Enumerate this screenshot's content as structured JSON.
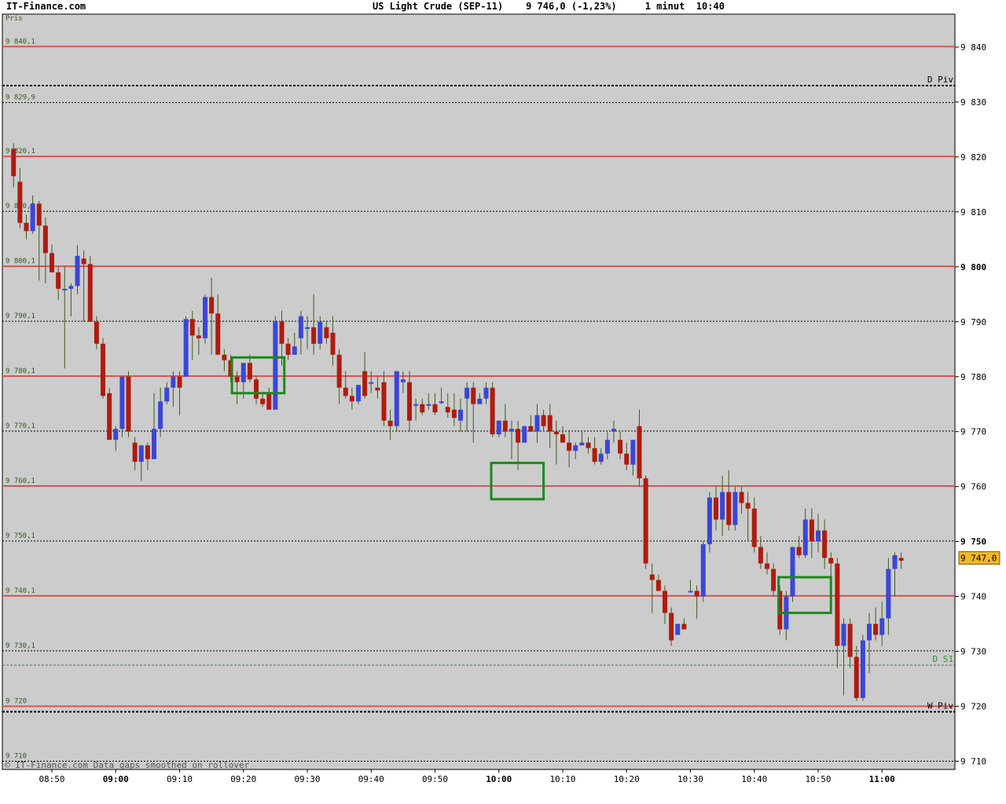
{
  "header": {
    "site": "IT-Finance.com",
    "title": "US Light Crude (SEP-11)    9 746,0 (-1,23%)     1 minut  10:40"
  },
  "chart_data": {
    "type": "candlestick",
    "ylim": [
      9708.5,
      9846
    ],
    "y_ticks": [
      {
        "v": 9840,
        "label": "9 840",
        "bold": false
      },
      {
        "v": 9830,
        "label": "9 830",
        "bold": false
      },
      {
        "v": 9820,
        "label": "9 820",
        "bold": false
      },
      {
        "v": 9810,
        "label": "9 810",
        "bold": false
      },
      {
        "v": 9800,
        "label": "9 800",
        "bold": true
      },
      {
        "v": 9790,
        "label": "9 790",
        "bold": false
      },
      {
        "v": 9780,
        "label": "9 780",
        "bold": false
      },
      {
        "v": 9770,
        "label": "9 770",
        "bold": false
      },
      {
        "v": 9760,
        "label": "9 760",
        "bold": false
      },
      {
        "v": 9750,
        "label": "9 750",
        "bold": true
      },
      {
        "v": 9740,
        "label": "9 740",
        "bold": false
      },
      {
        "v": 9730,
        "label": "9 730",
        "bold": false
      },
      {
        "v": 9720,
        "label": "9 720",
        "bold": false
      },
      {
        "v": 9710,
        "label": "9 710",
        "bold": false
      }
    ],
    "x_ticks": [
      {
        "t": 0,
        "label": "08:50",
        "bold": false
      },
      {
        "t": 10,
        "label": "09:00",
        "bold": true
      },
      {
        "t": 20,
        "label": "09:10",
        "bold": false
      },
      {
        "t": 30,
        "label": "09:20",
        "bold": false
      },
      {
        "t": 40,
        "label": "09:30",
        "bold": false
      },
      {
        "t": 50,
        "label": "09:40",
        "bold": false
      },
      {
        "t": 60,
        "label": "09:50",
        "bold": false
      },
      {
        "t": 70,
        "label": "10:00",
        "bold": true
      },
      {
        "t": 80,
        "label": "10:10",
        "bold": false
      },
      {
        "t": 90,
        "label": "10:20",
        "bold": false
      },
      {
        "t": 100,
        "label": "10:30",
        "bold": false
      },
      {
        "t": 110,
        "label": "10:40",
        "bold": false
      },
      {
        "t": 120,
        "label": "10:50",
        "bold": false
      },
      {
        "t": 130,
        "label": "11:00",
        "bold": true
      }
    ],
    "levels": [
      {
        "v": 9840.1,
        "label": "9 840,1",
        "style": "red"
      },
      {
        "v": 9829.9,
        "label": "9 829,9",
        "style": "dash"
      },
      {
        "v": 9820.1,
        "label": "9 820,1",
        "style": "red"
      },
      {
        "v": 9810.1,
        "label": "9 810,1",
        "style": "dash"
      },
      {
        "v": 9800.1,
        "label": "9 800,1",
        "style": "red"
      },
      {
        "v": 9790.1,
        "label": "9 790,1",
        "style": "dash"
      },
      {
        "v": 9780.1,
        "label": "9 780,1",
        "style": "red"
      },
      {
        "v": 9770.1,
        "label": "9 770,1",
        "style": "dash"
      },
      {
        "v": 9760.1,
        "label": "9 760,1",
        "style": "red"
      },
      {
        "v": 9750.1,
        "label": "9 750,1",
        "style": "dash"
      },
      {
        "v": 9740.1,
        "label": "9 740,1",
        "style": "red"
      },
      {
        "v": 9730.1,
        "label": "9 730,1",
        "style": "dash"
      },
      {
        "v": 9720,
        "label": "9 720",
        "style": "red"
      },
      {
        "v": 9710,
        "label": "9 710",
        "style": "dash"
      }
    ],
    "pivots": [
      {
        "v": 9833,
        "label": "D Piv",
        "color": "#000000",
        "style": "bold-dash"
      },
      {
        "v": 9727.5,
        "label": "D S1",
        "color": "#2e8b2e",
        "style": "green-dash"
      },
      {
        "v": 9719,
        "label": "W Piv",
        "color": "#000000",
        "style": "bold-dash"
      }
    ],
    "last_price": {
      "v": 9747,
      "label": "9 747,0"
    },
    "y_axis_title": "Pris",
    "footer": "© IT-Finance.com Data gaps smoothed on rollover",
    "colors": {
      "up": "#3a46d8",
      "down": "#b01b0f",
      "background": "#cccccc",
      "level_red": "#d9534f",
      "box": "#1a8a1a",
      "wick": "#405a20"
    },
    "highlight_boxes": [
      {
        "t0": 28.2,
        "t1": 36.4,
        "high": 9783.5,
        "low": 9777
      },
      {
        "t0": 68.8,
        "t1": 77,
        "high": 9764.3,
        "low": 9757.7
      },
      {
        "t0": 113.8,
        "t1": 122,
        "high": 9743.5,
        "low": 9737
      }
    ],
    "candles": [
      [
        -6,
        9821.5,
        9822.5,
        9814.5,
        9816.5
      ],
      [
        -5,
        9815.5,
        9818,
        9807,
        9808
      ],
      [
        -4,
        9808,
        9809.5,
        9805,
        9806.5
      ],
      [
        -3,
        9806.5,
        9813,
        9806,
        9811.5
      ],
      [
        -2,
        9811.5,
        9812,
        9797.5,
        9807.5
      ],
      [
        -1,
        9807.5,
        9809,
        9797,
        9802.5
      ],
      [
        0,
        9802.5,
        9804,
        9799,
        9799
      ],
      [
        1,
        9799,
        9800,
        9794,
        9796
      ],
      [
        2,
        9796,
        9800,
        9781.5,
        9796
      ],
      [
        3,
        9796,
        9797,
        9791,
        9796.5
      ],
      [
        4,
        9796.5,
        9804,
        9795,
        9802
      ],
      [
        5,
        9801.5,
        9803,
        9790,
        9800.5
      ],
      [
        6,
        9800.5,
        9802,
        9790,
        9790
      ],
      [
        7,
        9790,
        9791,
        9785,
        9786
      ],
      [
        8,
        9786,
        9787,
        9776,
        9776.5
      ],
      [
        9,
        9777,
        9778,
        9768.5,
        9768.5
      ],
      [
        10,
        9768.5,
        9771,
        9766.5,
        9770.5
      ],
      [
        11,
        9770.5,
        9780,
        9769,
        9780
      ],
      [
        12,
        9780,
        9781,
        9769,
        9770
      ],
      [
        13,
        9768,
        9769,
        9763,
        9764.5
      ],
      [
        14,
        9764.5,
        9765,
        9761,
        9767.5
      ],
      [
        15,
        9767.5,
        9768,
        9763,
        9765
      ],
      [
        16,
        9765,
        9777,
        9765,
        9770.5
      ],
      [
        17,
        9770.5,
        9778,
        9769,
        9775.5
      ],
      [
        18,
        9775.5,
        9779,
        9775,
        9778
      ],
      [
        19,
        9778,
        9781,
        9774.5,
        9780
      ],
      [
        20,
        9780,
        9781,
        9773,
        9778
      ],
      [
        21,
        9780,
        9791,
        9780,
        9790.5
      ],
      [
        22,
        9790.5,
        9792,
        9783,
        9787.5
      ],
      [
        23,
        9787.5,
        9789,
        9784,
        9787
      ],
      [
        24,
        9787,
        9795,
        9786,
        9794.5
      ],
      [
        25,
        9794.5,
        9798,
        9784,
        9791.5
      ],
      [
        26,
        9791.5,
        9795,
        9784,
        9784
      ],
      [
        27,
        9784,
        9785,
        9781,
        9783
      ],
      [
        28,
        9783,
        9784,
        9779,
        9780
      ],
      [
        29,
        9780,
        9781,
        9775,
        9779
      ],
      [
        30,
        9779,
        9782,
        9776,
        9782.5
      ],
      [
        31,
        9782.5,
        9784,
        9779,
        9779.5
      ],
      [
        32,
        9779.5,
        9780,
        9775,
        9776
      ],
      [
        33,
        9776,
        9777,
        9774.5,
        9775
      ],
      [
        34,
        9777,
        9778,
        9774,
        9774
      ],
      [
        35,
        9774,
        9791,
        9774,
        9790
      ],
      [
        36,
        9790,
        9792,
        9782,
        9786
      ],
      [
        37,
        9786,
        9787,
        9783,
        9784
      ],
      [
        38,
        9784,
        9788,
        9784,
        9785.5
      ],
      [
        39,
        9787,
        9792,
        9784,
        9791
      ],
      [
        40,
        9789,
        9791,
        9785,
        9789
      ],
      [
        41,
        9789,
        9795,
        9784,
        9786
      ],
      [
        42,
        9786,
        9791,
        9785,
        9790
      ],
      [
        43,
        9789,
        9790,
        9786,
        9787
      ],
      [
        44,
        9788,
        9791,
        9782,
        9784
      ],
      [
        45,
        9784,
        9785,
        9775,
        9778
      ],
      [
        46,
        9778,
        9781,
        9776,
        9776.5
      ],
      [
        47,
        9776.5,
        9778,
        9774,
        9775.5
      ],
      [
        48,
        9775.5,
        9778,
        9775,
        9778.5
      ],
      [
        49,
        9781,
        9784.5,
        9776,
        9776.5
      ],
      [
        50,
        9779,
        9781,
        9777,
        9779
      ],
      [
        51,
        9778,
        9780,
        9776,
        9777.5
      ],
      [
        52,
        9779,
        9781,
        9771,
        9772
      ],
      [
        53,
        9772,
        9774,
        9768.5,
        9771
      ],
      [
        54,
        9771,
        9776,
        9770,
        9781
      ],
      [
        55,
        9779,
        9781,
        9777,
        9779.5
      ],
      [
        56,
        9779,
        9781,
        9770,
        9772
      ],
      [
        57,
        9775,
        9776,
        9772,
        9775
      ],
      [
        58,
        9775,
        9776,
        9773,
        9773.5
      ],
      [
        59,
        9775,
        9777,
        9774,
        9775
      ],
      [
        60,
        9775,
        9777,
        9773,
        9773.5
      ],
      [
        61,
        9775.5,
        9778,
        9775,
        9775.5
      ],
      [
        62,
        9774.5,
        9777,
        9772.5,
        9773.5
      ],
      [
        63,
        9774,
        9777,
        9771,
        9772.5
      ],
      [
        64,
        9772,
        9776,
        9770,
        9774
      ],
      [
        65,
        9776,
        9779,
        9770,
        9778
      ],
      [
        66,
        9778,
        9779,
        9768,
        9775
      ],
      [
        67,
        9775,
        9777,
        9775,
        9776
      ],
      [
        68,
        9776,
        9779,
        9775,
        9778
      ],
      [
        69,
        9778,
        9779,
        9769,
        9769.5
      ],
      [
        70,
        9769.5,
        9772,
        9769,
        9772
      ],
      [
        71,
        9772,
        9775,
        9769,
        9770
      ],
      [
        72,
        9770,
        9772,
        9765,
        9770.5
      ],
      [
        73,
        9770.5,
        9772,
        9763,
        9768
      ],
      [
        74,
        9768,
        9771,
        9768,
        9771
      ],
      [
        75,
        9771,
        9773,
        9770,
        9770
      ],
      [
        76,
        9770,
        9775,
        9768,
        9773
      ],
      [
        77,
        9773,
        9774,
        9770,
        9771
      ],
      [
        78,
        9773,
        9775,
        9767,
        9770
      ],
      [
        79,
        9770,
        9772,
        9764,
        9769.5
      ],
      [
        80,
        9769.5,
        9771,
        9768,
        9768
      ],
      [
        81,
        9768,
        9770,
        9763.5,
        9766.5
      ],
      [
        82,
        9766.5,
        9768,
        9765,
        9767.5
      ],
      [
        83,
        9767.5,
        9770,
        9768,
        9768
      ],
      [
        84,
        9768,
        9769,
        9766,
        9767
      ],
      [
        85,
        9767,
        9769,
        9764,
        9764.5
      ],
      [
        86,
        9764.5,
        9767,
        9764,
        9766
      ],
      [
        87,
        9766,
        9770,
        9765,
        9768.5
      ],
      [
        88,
        9770,
        9772,
        9768,
        9770.5
      ],
      [
        89,
        9768.5,
        9770,
        9765,
        9766
      ],
      [
        90,
        9766,
        9768,
        9763,
        9764
      ],
      [
        91,
        9764,
        9765,
        9762,
        9768.5
      ],
      [
        92,
        9771,
        9774,
        9760,
        9761.5
      ],
      [
        93,
        9761.5,
        9762,
        9745,
        9746
      ],
      [
        94,
        9744,
        9746,
        9737,
        9743
      ],
      [
        95,
        9743,
        9744,
        9741,
        9741
      ],
      [
        96,
        9741,
        9742,
        9735,
        9737
      ],
      [
        97,
        9737,
        9738,
        9731,
        9732
      ],
      [
        98,
        9733,
        9734,
        9734,
        9735
      ],
      [
        99,
        9735,
        9736,
        9738,
        9734
      ],
      [
        100,
        9741,
        9743,
        9742,
        9741
      ],
      [
        101,
        9741,
        9742,
        9736,
        9740
      ],
      [
        102,
        9740,
        9750,
        9739,
        9749.5
      ],
      [
        103,
        9749.5,
        9759,
        9748,
        9758
      ],
      [
        104,
        9758,
        9760,
        9752,
        9754
      ],
      [
        105,
        9754,
        9762,
        9751,
        9759
      ],
      [
        106,
        9759,
        9763,
        9752,
        9753
      ],
      [
        107,
        9753,
        9760,
        9752,
        9759
      ],
      [
        108,
        9759,
        9760,
        9755,
        9757
      ],
      [
        109,
        9757,
        9759,
        9750,
        9756
      ],
      [
        110,
        9756,
        9758,
        9748,
        9749
      ],
      [
        111,
        9749,
        9751,
        9745,
        9746
      ],
      [
        112,
        9746,
        9748,
        9744,
        9745
      ],
      [
        113,
        9745,
        9746,
        9740,
        9741
      ],
      [
        114,
        9741,
        9742,
        9733,
        9734
      ],
      [
        115,
        9734,
        9741,
        9732,
        9740
      ],
      [
        116,
        9740,
        9749,
        9739,
        9749
      ],
      [
        117,
        9749,
        9751,
        9747,
        9747.5
      ],
      [
        118,
        9747.5,
        9756,
        9747,
        9754
      ],
      [
        119,
        9754,
        9756,
        9747,
        9750
      ],
      [
        120,
        9750,
        9755,
        9748,
        9752
      ],
      [
        121,
        9752,
        9754,
        9745,
        9747
      ],
      [
        122,
        9747,
        9748,
        9738,
        9746
      ],
      [
        123,
        9746,
        9747,
        9727,
        9731
      ],
      [
        124,
        9731,
        9736,
        9722,
        9735
      ],
      [
        125,
        9735,
        9736,
        9727,
        9729
      ],
      [
        126,
        9729,
        9731,
        9721,
        9721.5
      ],
      [
        127,
        9721.5,
        9733,
        9721,
        9732
      ],
      [
        128,
        9732,
        9737,
        9726,
        9735
      ],
      [
        129,
        9735,
        9738,
        9732,
        9733
      ],
      [
        130,
        9733,
        9739,
        9731,
        9736
      ],
      [
        131,
        9736,
        9747,
        9733,
        9745
      ],
      [
        132,
        9745,
        9748,
        9740,
        9747.5
      ],
      [
        133,
        9747,
        9748,
        9745,
        9746.5
      ]
    ]
  }
}
